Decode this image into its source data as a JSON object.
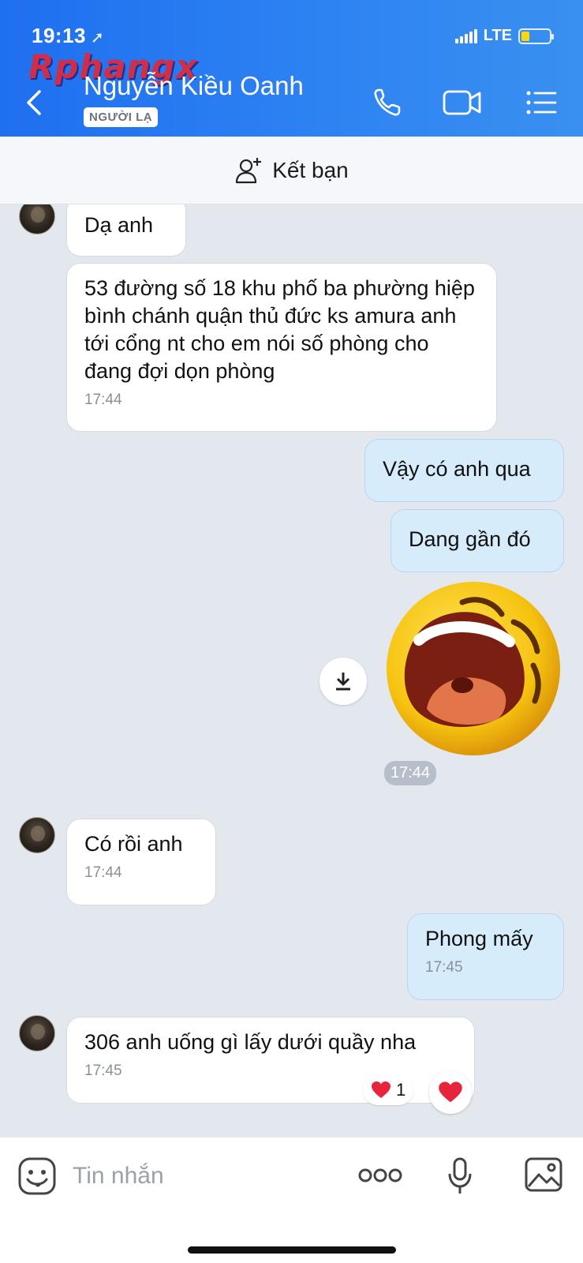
{
  "status_bar": {
    "time": "19:13",
    "network": "LTE"
  },
  "watermark": "Rphangx",
  "header": {
    "contact_name": "Nguyễn Kiều Oanh",
    "badge": "NGƯỜI LẠ",
    "icons": [
      "back-icon",
      "phone-icon",
      "video-call-icon",
      "menu-icon"
    ]
  },
  "add_friend": {
    "label": "Kết bạn"
  },
  "messages": [
    {
      "direction": "in",
      "text": "Dạ anh"
    },
    {
      "direction": "in",
      "text": "53 đường số 18 khu phố ba phường hiệp bình chánh quận thủ đức ks amura anh tới cổng nt cho em nói số phòng cho đang đợi dọn phòng",
      "time": "17:44"
    },
    {
      "direction": "out",
      "text": "Vậy có anh qua"
    },
    {
      "direction": "out",
      "text": "Dang gần đó"
    },
    {
      "direction": "out",
      "type": "sticker",
      "sticker": "laughing-emoji",
      "time": "17:44"
    },
    {
      "direction": "in",
      "text": "Có rồi anh",
      "time": "17:44"
    },
    {
      "direction": "out",
      "text": "Phong mấy",
      "time": "17:45"
    },
    {
      "direction": "in",
      "text": "306 anh uống gì lấy dưới quầy nha",
      "time": "17:45",
      "reaction": {
        "emoji": "heart",
        "count": "1"
      }
    }
  ],
  "input_bar": {
    "placeholder": "Tin nhắn"
  },
  "colors": {
    "header_blue": "#2f84f2",
    "out_bubble": "#d6ecfb",
    "in_bubble": "#ffffff",
    "chat_bg": "#e3e8ef",
    "heart": "#e8243c"
  }
}
